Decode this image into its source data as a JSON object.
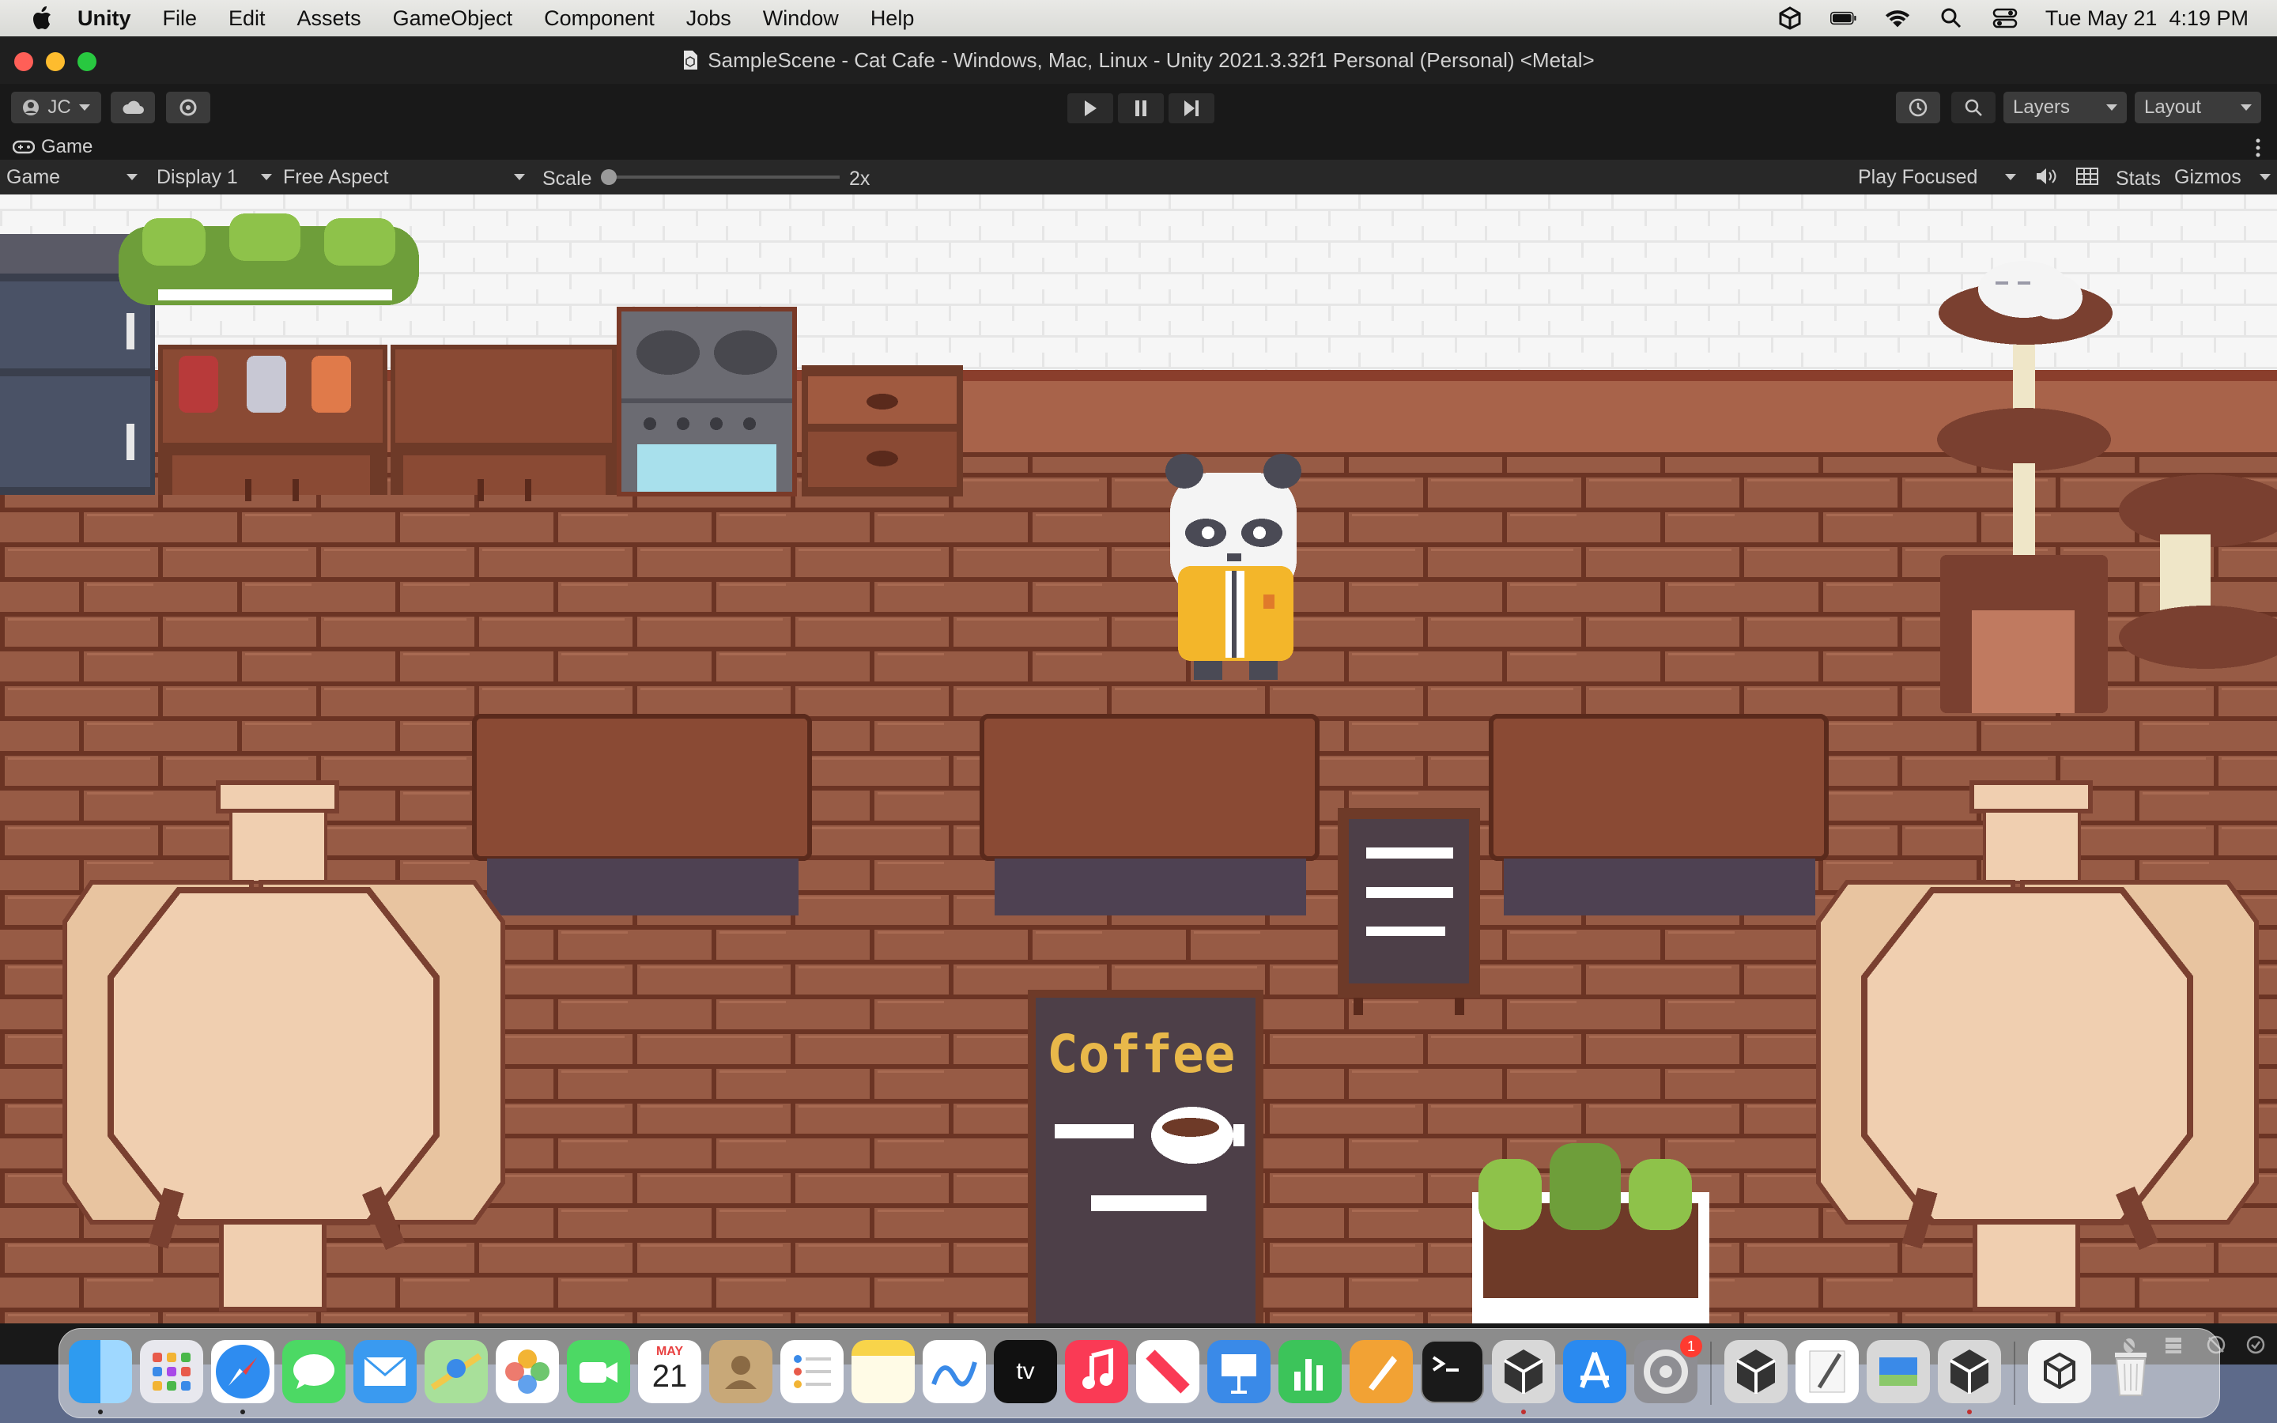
{
  "menubar": {
    "app_name": "Unity",
    "items": [
      "File",
      "Edit",
      "Assets",
      "GameObject",
      "Component",
      "Jobs",
      "Window",
      "Help"
    ],
    "clock": "Tue May 21  4:19 PM"
  },
  "window": {
    "title": "SampleScene - Cat Cafe - Windows, Mac, Linux - Unity 2021.3.32f1 Personal (Personal) <Metal>"
  },
  "toolbar": {
    "account_label": "JC",
    "layers_label": "Layers",
    "layout_label": "Layout"
  },
  "game_tab": {
    "label": "Game"
  },
  "game_toolbar": {
    "view_select": "Game",
    "display_select": "Display 1",
    "aspect_select": "Free Aspect",
    "scale_label": "Scale",
    "scale_value": "2x",
    "play_mode_select": "Play Focused",
    "stats_label": "Stats",
    "gizmos_label": "Gizmos"
  },
  "scene": {
    "sign_text": "Coffee"
  },
  "dock": {
    "calendar_month": "MAY",
    "calendar_day": "21",
    "appletv_label": "tv",
    "settings_badge": "1"
  },
  "colors": {
    "wall_white": "#f4f4f4",
    "wall_border": "#8a3e2c",
    "floor_brown": "#965a44",
    "floor_line": "#6b3424",
    "counter_top": "#8a4a34",
    "counter_side": "#4e4152",
    "table_wood": "#f0cfb0",
    "sign_bg": "#4d3f48",
    "coffee_text": "#e8b84a"
  }
}
